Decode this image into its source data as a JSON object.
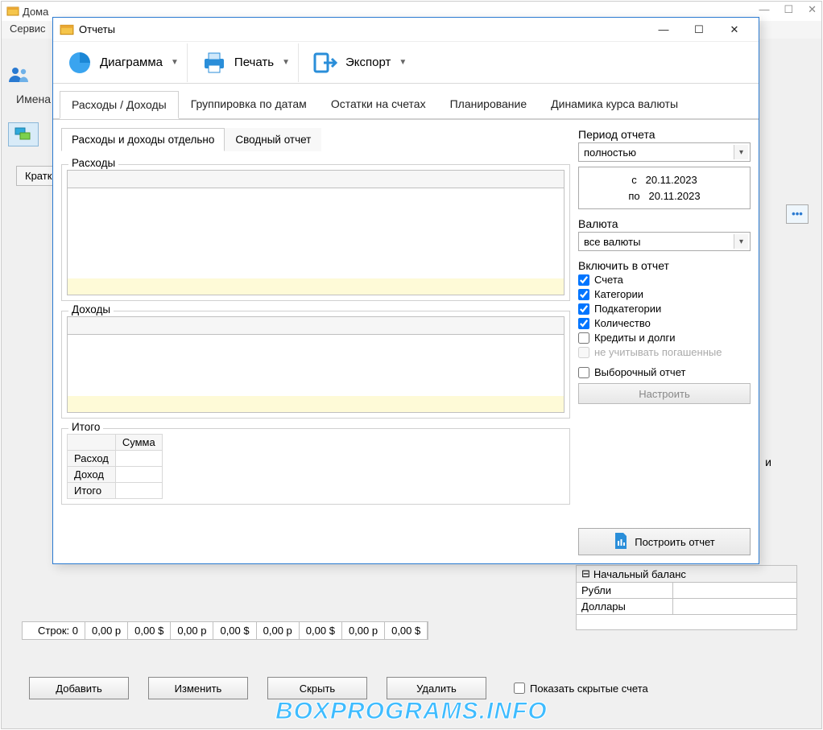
{
  "bg_window": {
    "title_fragment": "Дома",
    "menu_service": "Сервис",
    "names_btn": "Имена",
    "kratk_btn": "Кратк",
    "more_btn": "•••",
    "bottom_cells": [
      "Строк: 0",
      "0,00 р",
      "0,00 $",
      "0,00 р",
      "0,00 $",
      "0,00 р",
      "0,00 $",
      "0,00 р",
      "0,00 $"
    ],
    "buttons": {
      "add": "Добавить",
      "edit": "Изменить",
      "hide": "Скрыть",
      "delete": "Удалить"
    },
    "show_hidden": "Показать скрытые счета",
    "balance": {
      "header": "Начальный баланс",
      "rows": [
        "Рубли",
        "Доллары"
      ]
    },
    "side_char": "и"
  },
  "modal": {
    "title": "Отчеты",
    "ribbon": {
      "chart": "Диаграмма",
      "print": "Печать",
      "export": "Экспорт"
    },
    "tabs": [
      "Расходы / Доходы",
      "Группировка по датам",
      "Остатки на счетах",
      "Планирование",
      "Динамика курса валюты"
    ],
    "subtabs": [
      "Расходы и доходы отдельно",
      "Сводный отчет"
    ],
    "groups": {
      "expenses": "Расходы",
      "income": "Доходы",
      "totals": "Итого"
    },
    "totals_table": {
      "col": "Сумма",
      "rows": [
        "Расход",
        "Доход",
        "Итого"
      ]
    },
    "period": {
      "label": "Период отчета",
      "value": "полностью",
      "from_lbl": "с",
      "from": "20.11.2023",
      "to_lbl": "по",
      "to": "20.11.2023"
    },
    "currency": {
      "label": "Валюта",
      "value": "все валюты"
    },
    "include": {
      "label": "Включить в отчет",
      "accounts": "Счета",
      "categories": "Категории",
      "subcategories": "Подкатегории",
      "quantity": "Количество",
      "credits": "Кредиты и долги",
      "ignore_paid": "не учитывать погашенные"
    },
    "selective": "Выборочный отчет",
    "configure_btn": "Настроить",
    "build_btn": "Построить отчет"
  },
  "watermark": "BOXPROGRAMS.INFO"
}
